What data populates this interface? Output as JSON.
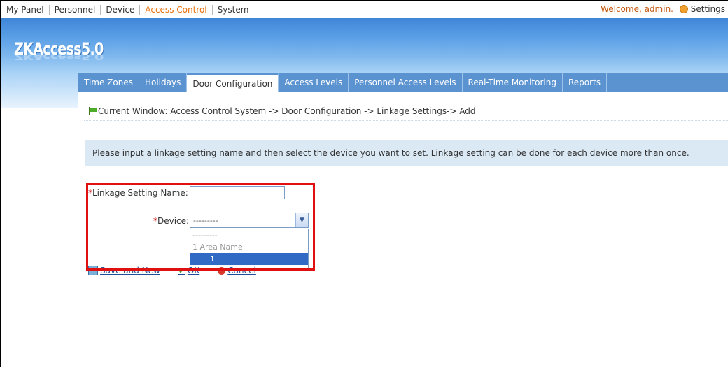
{
  "top_menu": {
    "items": [
      "My Panel",
      "Personnel",
      "Device",
      "Access Control",
      "System"
    ],
    "active_index": 3,
    "welcome": "Welcome, admin.",
    "settings": "Settings"
  },
  "banner": {
    "logo": "ZKAccess5.0"
  },
  "tabs": [
    "Time Zones",
    "Holidays",
    "Door Configuration",
    "Access Levels",
    "Personnel Access Levels",
    "Real-Time Monitoring",
    "Reports"
  ],
  "active_tab": 2,
  "breadcrumb": "Current Window: Access Control System -> Door Configuration -> Linkage Settings-> Add",
  "info": "Please input a linkage setting name and then select the device you want to set. Linkage setting can be done for each device more than once.",
  "form": {
    "required_mark": "*",
    "linkage_name_label": "Linkage Setting Name:",
    "linkage_name_value": "",
    "device_label": "Device:",
    "device_selected": "---------",
    "device_options": [
      "---------",
      "1 Area Name",
      "1"
    ]
  },
  "actions": {
    "save_and_new": "Save and New",
    "ok": "OK",
    "cancel": "Cancel"
  },
  "colors": {
    "accent": "#e8730f",
    "tabbar": "#5b93d1",
    "highlight": "#e01010"
  }
}
